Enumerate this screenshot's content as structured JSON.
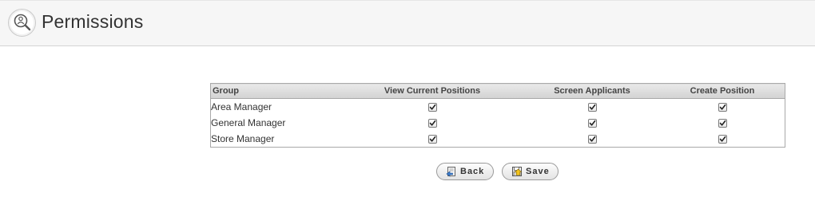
{
  "header": {
    "title": "Permissions",
    "icon": "user-search-icon"
  },
  "table": {
    "columns": [
      "Group",
      "View Current Positions",
      "Screen Applicants",
      "Create Position"
    ],
    "rows": [
      {
        "group": "Area Manager",
        "view": true,
        "screen": true,
        "create": true
      },
      {
        "group": "General Manager",
        "view": true,
        "screen": true,
        "create": true
      },
      {
        "group": "Store Manager",
        "view": true,
        "screen": true,
        "create": true
      }
    ]
  },
  "buttons": {
    "back_label": "Back",
    "back_icon": "back-document-icon",
    "save_label": "Save",
    "save_icon": "save-disk-icon"
  }
}
